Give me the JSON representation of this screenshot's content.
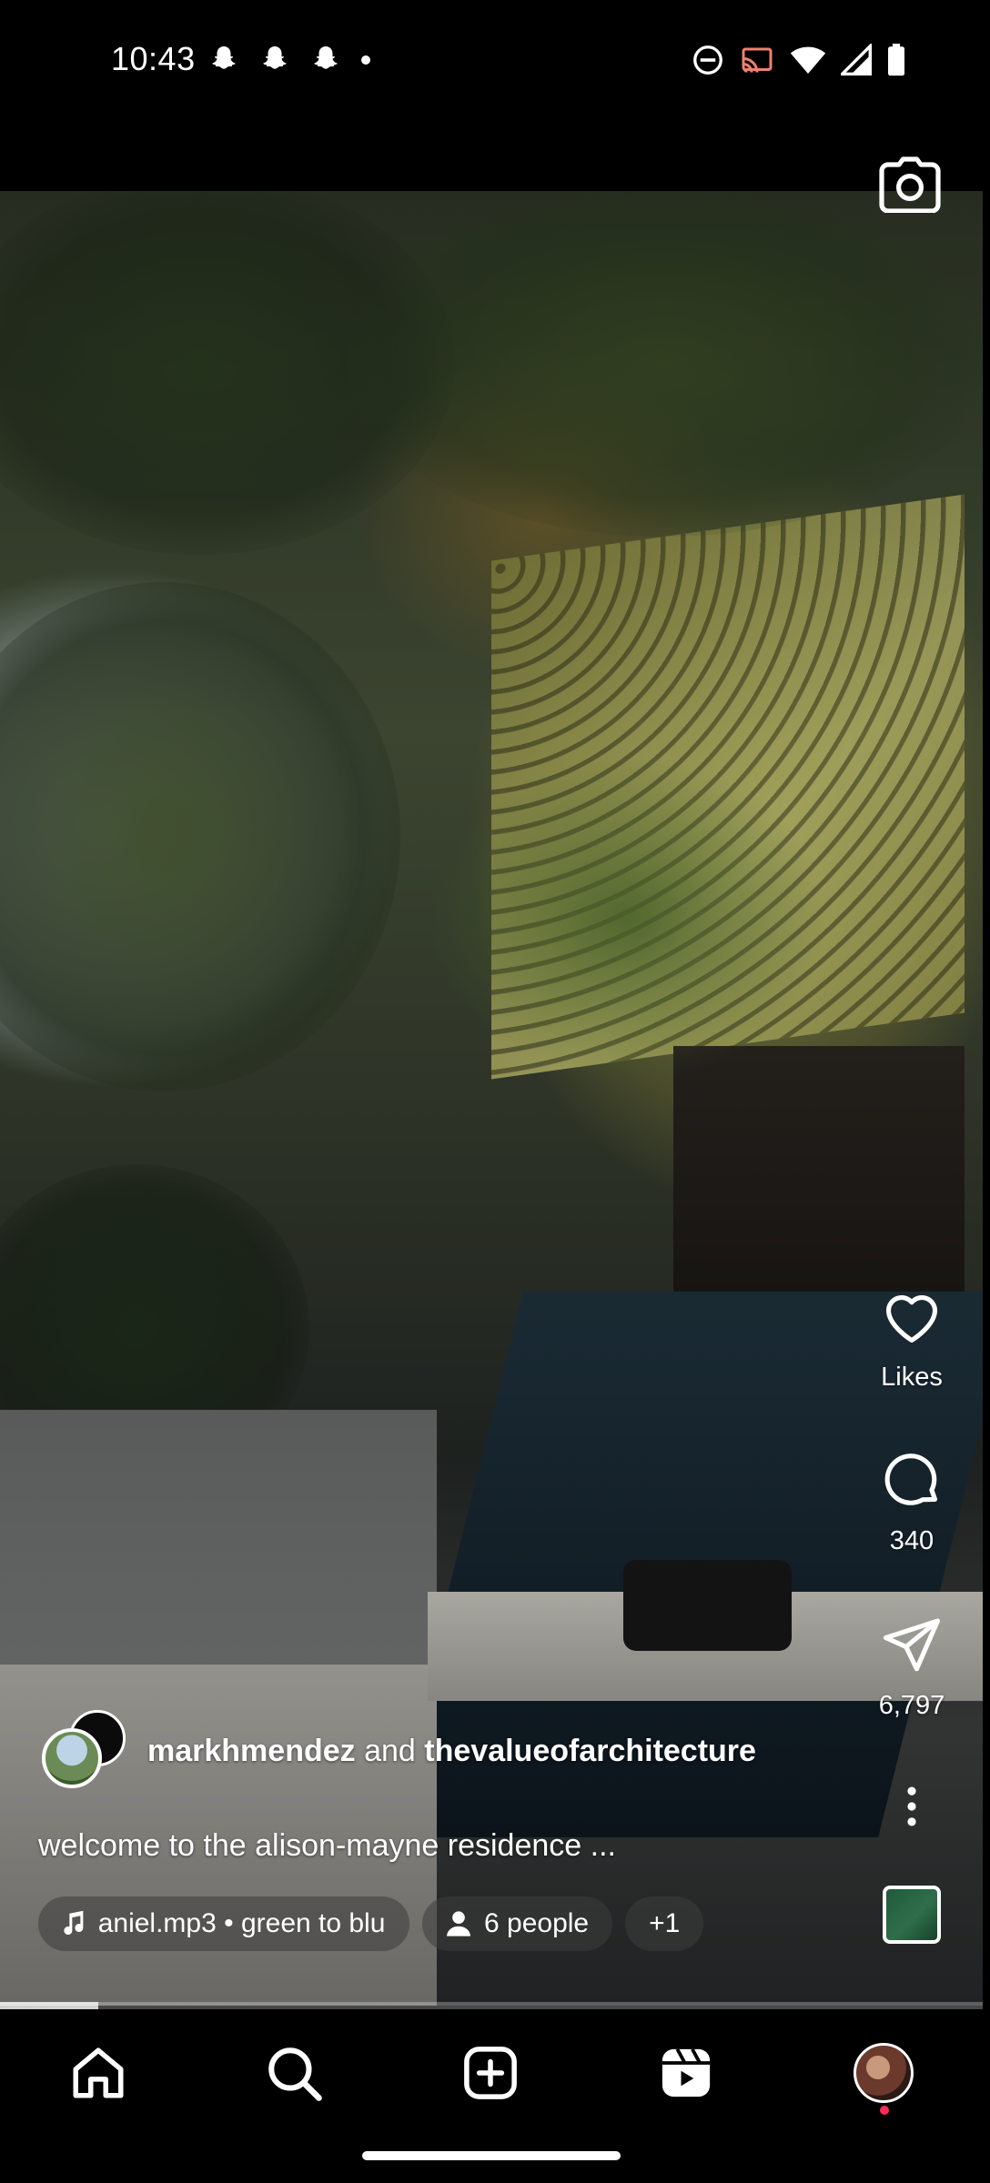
{
  "status_bar": {
    "time": "10:43",
    "left_icons": [
      "snapchat-icon",
      "snapchat-icon",
      "snapchat-icon",
      "dot-icon"
    ],
    "right_icons": [
      "do-not-disturb-icon",
      "cast-icon",
      "wifi-icon",
      "signal-icon",
      "battery-icon"
    ]
  },
  "reel": {
    "camera_icon": "camera-icon",
    "actions": {
      "like_label": "Likes",
      "comment_count": "340",
      "share_count": "6,797"
    },
    "author": {
      "user1": "markhmendez",
      "conjunction": "and",
      "user2": "thevalueofarchitecture"
    },
    "caption": "welcome to the alison-mayne residence ...",
    "audio_pill": "aniel.mp3 • green to blu",
    "people_pill": "6 people",
    "more_pill": "+1",
    "progress": 0.1
  },
  "bottom_nav": {
    "items": [
      "home-icon",
      "search-icon",
      "create-icon",
      "reels-icon",
      "profile-avatar"
    ]
  },
  "colors": {
    "background": "#000000",
    "text": "#ffffff",
    "notification_dot": "#ff2a55"
  }
}
